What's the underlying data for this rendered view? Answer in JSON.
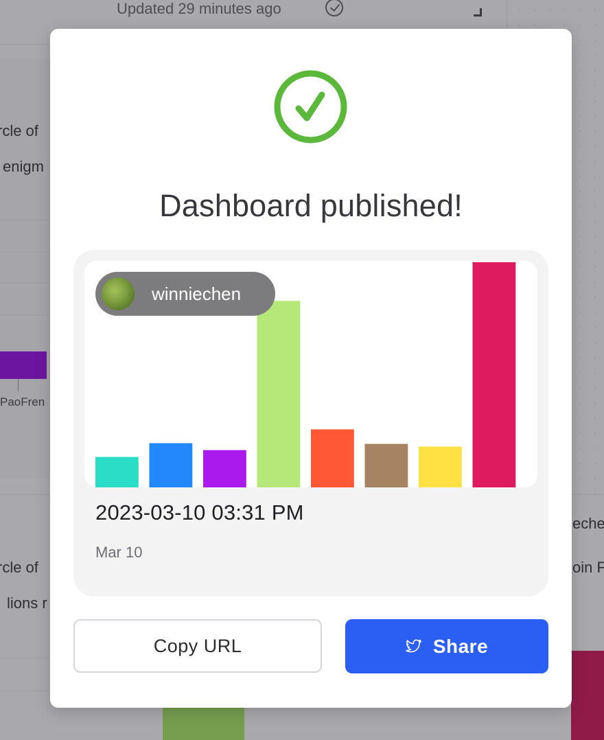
{
  "background": {
    "updated_text": "Updated 29 minutes ago",
    "snippets": [
      "rcle of",
      "enigm",
      "PaoFren",
      "rcle of",
      "lions r",
      "eche",
      "oin F"
    ]
  },
  "modal": {
    "title": "Dashboard published!",
    "preview": {
      "author": "winniechen",
      "date": "2023-03-10 03:31 PM",
      "subdate": "Mar 10"
    },
    "buttons": {
      "copy_label": "Copy URL",
      "share_label": "Share"
    }
  },
  "colors": {
    "success": "#5cb83a",
    "primary": "#2b5ff3"
  },
  "chart_data": {
    "type": "bar",
    "values": [
      44,
      64,
      54,
      270,
      84,
      63,
      59,
      326
    ],
    "colors": [
      "#2bddc7",
      "#2288fb",
      "#ab1aed",
      "#b5e878",
      "#ff5837",
      "#a68463",
      "#ffe143",
      "#de1b5e"
    ]
  }
}
